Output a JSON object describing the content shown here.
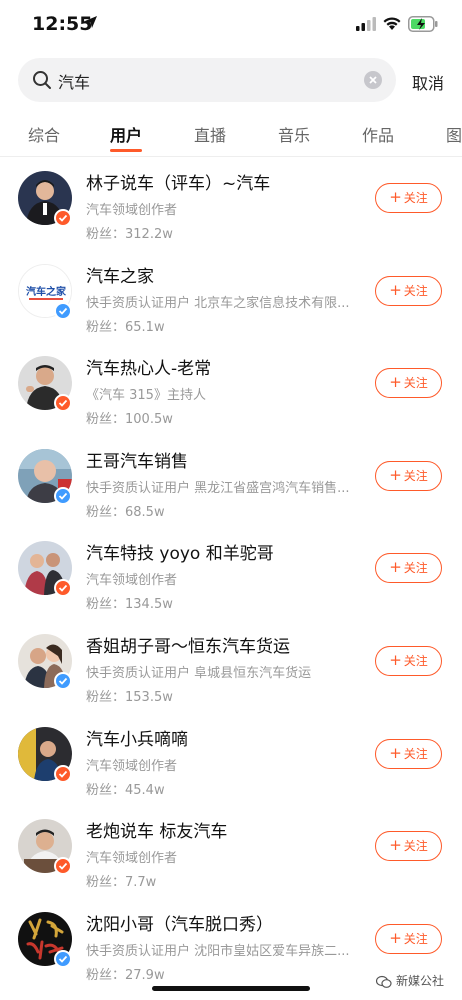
{
  "status_bar": {
    "time": "12:55"
  },
  "search": {
    "query": "汽车",
    "cancel_label": "取消"
  },
  "tabs": [
    {
      "label": "综合"
    },
    {
      "label": "用户"
    },
    {
      "label": "直播"
    },
    {
      "label": "音乐"
    },
    {
      "label": "作品"
    },
    {
      "label": "图"
    }
  ],
  "active_tab": "用户",
  "follow_label": "关注",
  "accent_color": "#fe5a2a",
  "users": [
    {
      "name": "林子说车（评车）~汽车",
      "desc": "汽车领域创作者",
      "fans": "粉丝：312.2w",
      "badge": "orange"
    },
    {
      "name": "汽车之家",
      "desc": "快手资质认证用户  北京车之家信息技术有限...",
      "fans": "粉丝：65.1w",
      "badge": "blue"
    },
    {
      "name": "汽车热心人-老常",
      "desc": "《汽车 315》主持人",
      "fans": "粉丝：100.5w",
      "badge": "orange"
    },
    {
      "name": "王哥汽车销售",
      "desc": "快手资质认证用户  黑龙江省盛宫鸿汽车销售...",
      "fans": "粉丝：68.5w",
      "badge": "blue"
    },
    {
      "name": "汽车特技 yoyo 和羊驼哥",
      "desc": "汽车领域创作者",
      "fans": "粉丝：134.5w",
      "badge": "orange"
    },
    {
      "name": "香姐胡子哥～恒东汽车货运",
      "desc": "快手资质认证用户  阜城县恒东汽车货运",
      "fans": "粉丝：153.5w",
      "badge": "blue"
    },
    {
      "name": "汽车小兵嘀嘀",
      "desc": "汽车领域创作者",
      "fans": "粉丝：45.4w",
      "badge": "orange"
    },
    {
      "name": "老炮说车 标友汽车",
      "desc": "汽车领域创作者",
      "fans": "粉丝：7.7w",
      "badge": "orange"
    },
    {
      "name": "沈阳小哥（汽车脱口秀）",
      "desc": "快手资质认证用户  沈阳市皇姑区爱车异族二...",
      "fans": "粉丝：27.9w",
      "badge": "blue"
    }
  ],
  "avatar_logo_text": "汽车之家",
  "watermark": "新媒公社"
}
